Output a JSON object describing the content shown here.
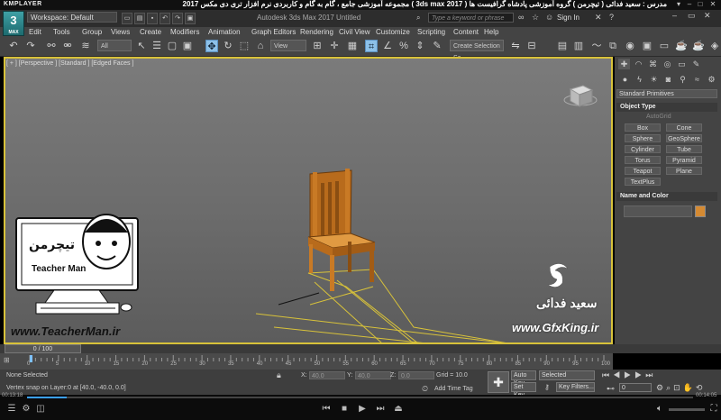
{
  "player": {
    "logo_text": "KMPLAYER",
    "title": "مجموعه آموزشی جامع ، گام به گام و کاربردی نرم افزار تری دی مکس 2017 ( 3ds max 2017 ) مدرس : سعید فدائی ( تیچرمن ) گروه آموزشی پادشاه گرافیست ها",
    "elapsed": "00:13:18",
    "total": "00:14:05",
    "progress": 0.06
  },
  "app": {
    "logo_number": "3",
    "logo_sub": "MAX",
    "workspace": "Workspace: Default",
    "title": "Autodesk 3ds Max 2017    Untitled",
    "search_placeholder": "Type a keyword or phrase",
    "sign_in": "Sign In"
  },
  "menu": [
    "Edit",
    "Tools",
    "Group",
    "Views",
    "Create",
    "Modifiers",
    "Animation",
    "Graph Editors",
    "Rendering",
    "Civil View",
    "Customize",
    "Scripting",
    "Content",
    "Help"
  ],
  "toolbar": {
    "filter_value": "All",
    "view_value": "View",
    "selection_set": "Create Selection Se"
  },
  "viewport": {
    "label": "[ + ] [Perspective ] [Standard ] [Edged Faces ]"
  },
  "command_panel": {
    "dropdown": "Standard Primitives",
    "object_type_title": "Object Type",
    "autogrid": "AutoGrid",
    "primitives": [
      "Box",
      "Cone",
      "Sphere",
      "GeoSphere",
      "Cylinder",
      "Tube",
      "Torus",
      "Pyramid",
      "Teapot",
      "Plane",
      "TextPlus"
    ],
    "name_color_title": "Name and Color",
    "object_color": "#d58a32"
  },
  "timeline": {
    "frame_display": "0 / 100",
    "ticks": [
      "0",
      "5",
      "10",
      "15",
      "20",
      "25",
      "30",
      "35",
      "40",
      "45",
      "50",
      "55",
      "60",
      "65",
      "70",
      "75",
      "80",
      "85",
      "90",
      "95",
      "100"
    ]
  },
  "status": {
    "selection": "None Selected",
    "prompt": "Vertex snap on Layer:0 at [40.0, -40.0, 0.0]",
    "x_label": "X:",
    "x_value": "40.0",
    "y_label": "Y:",
    "y_value": "40.0",
    "z_label": "Z:",
    "z_value": "0.0",
    "grid": "Grid = 10.0",
    "add_time_tag": "Add Time Tag",
    "auto_key": "Auto Key",
    "set_key": "Set Key",
    "selected": "Selected",
    "key_filters": "Key Filters...",
    "frame_field": "0"
  },
  "overlay": {
    "teacher_name": "Teacher Man",
    "teacher_site": "www.TeacherMan.ir",
    "gfx_site": "www.GfxKing.ir",
    "gfx_name": "سعید فدائی"
  }
}
